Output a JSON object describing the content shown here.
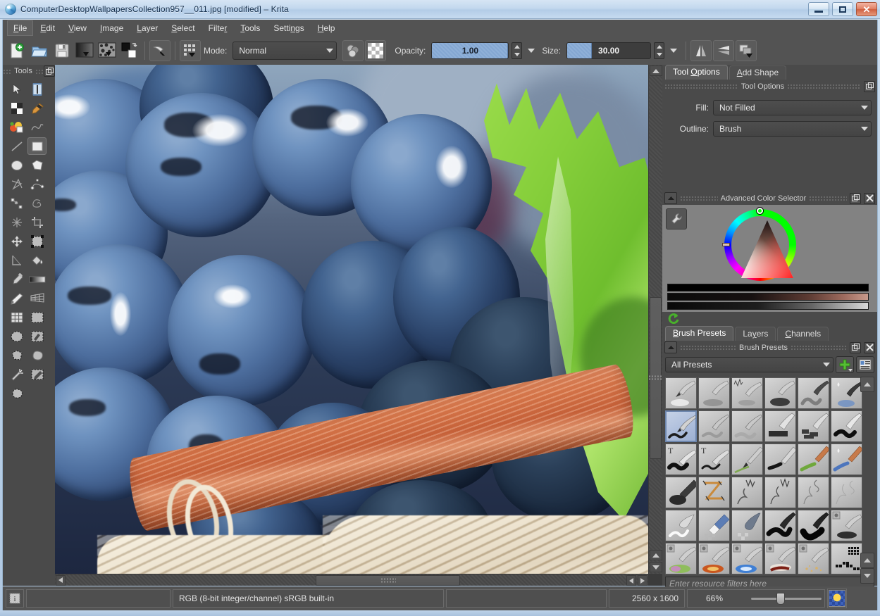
{
  "window": {
    "title": "ComputerDesktopWallpapersCollection957__011.jpg [modified] – Krita",
    "app_icon": "krita-logo-icon",
    "buttons": {
      "minimize": "minimize-icon",
      "maximize": "maximize-icon",
      "close": "close-icon"
    }
  },
  "menubar": {
    "items": [
      {
        "label": "File",
        "mnemonic": "F",
        "active": true
      },
      {
        "label": "Edit",
        "mnemonic": "E",
        "active": false
      },
      {
        "label": "View",
        "mnemonic": "V",
        "active": false
      },
      {
        "label": "Image",
        "mnemonic": "I",
        "active": false
      },
      {
        "label": "Layer",
        "mnemonic": "L",
        "active": false
      },
      {
        "label": "Select",
        "mnemonic": "S",
        "active": false
      },
      {
        "label": "Filter",
        "mnemonic": "r",
        "active": false
      },
      {
        "label": "Tools",
        "mnemonic": "T",
        "active": false
      },
      {
        "label": "Settings",
        "mnemonic": "n",
        "active": false
      },
      {
        "label": "Help",
        "mnemonic": "H",
        "active": false
      }
    ]
  },
  "toolbar": {
    "buttons": [
      {
        "name": "new-document-button",
        "icon": "new-document-icon"
      },
      {
        "name": "open-document-button",
        "icon": "open-folder-icon"
      },
      {
        "name": "save-document-button",
        "icon": "floppy-disk-icon"
      },
      {
        "name": "gradient-button",
        "icon": "gradient-swatch-icon"
      },
      {
        "name": "pattern-button",
        "icon": "pattern-swatch-icon"
      },
      {
        "name": "foreground-background-color-button",
        "icon": "color-swatches-icon"
      },
      {
        "name": "brush-preset-button",
        "icon": "brush-tip-icon"
      },
      {
        "name": "brush-editor-button",
        "icon": "brush-settings-icon"
      }
    ],
    "mode_label": "Mode:",
    "mode_value": "Normal",
    "alpha_lock_button": "alpha-lock-icon",
    "erase_mode_button": "eraser-checker-icon",
    "opacity_label": "Opacity:",
    "opacity_value": "1.00",
    "opacity_fill_percent": 100,
    "size_label": "Size:",
    "size_value": "30.00",
    "size_fill_percent": 30,
    "right_buttons": [
      {
        "name": "mirror-horizontal-button",
        "icon": "mirror-horizontal-icon"
      },
      {
        "name": "mirror-vertical-button",
        "icon": "mirror-vertical-icon"
      },
      {
        "name": "workspace-button",
        "icon": "workspace-icon"
      }
    ]
  },
  "tools_dock": {
    "title": "Tools",
    "float_button": "float-docker-icon",
    "tools": [
      {
        "name": "shape-select-tool",
        "icon": "cursor-arrow-icon",
        "selected": false
      },
      {
        "name": "text-tool",
        "icon": "text-tool-icon",
        "selected": false
      },
      {
        "name": "pattern-edit-tool",
        "icon": "checker-pattern-icon",
        "selected": false
      },
      {
        "name": "calligraphy-tool",
        "icon": "calligraphy-pen-icon",
        "selected": false
      },
      {
        "name": "gradient-edit-tool",
        "icon": "gradient-edit-icon",
        "selected": false
      },
      {
        "name": "freehand-path-tool",
        "icon": "freehand-squiggle-icon",
        "selected": false
      },
      {
        "name": "line-tool",
        "icon": "line-diagonal-icon",
        "selected": false
      },
      {
        "name": "rectangle-tool",
        "icon": "rectangle-icon",
        "selected": true
      },
      {
        "name": "ellipse-tool",
        "icon": "ellipse-icon",
        "selected": false
      },
      {
        "name": "polygon-tool",
        "icon": "polygon-icon",
        "selected": false
      },
      {
        "name": "polyline-tool",
        "icon": "polyline-star-icon",
        "selected": false
      },
      {
        "name": "bezier-curve-tool",
        "icon": "bezier-curve-icon",
        "selected": false
      },
      {
        "name": "path-edit-tool",
        "icon": "path-nodes-icon",
        "selected": false
      },
      {
        "name": "dynamic-brush-tool",
        "icon": "dynamic-spiral-icon",
        "selected": false
      },
      {
        "name": "multibrush-tool",
        "icon": "multibrush-star-icon",
        "selected": false
      },
      {
        "name": "crop-tool",
        "icon": "crop-icon",
        "selected": false
      },
      {
        "name": "move-tool",
        "icon": "move-cross-icon",
        "selected": false
      },
      {
        "name": "transform-tool",
        "icon": "transform-icon",
        "selected": false
      },
      {
        "name": "measure-tool",
        "icon": "measure-angle-icon",
        "selected": false
      },
      {
        "name": "fill-tool",
        "icon": "paint-bucket-icon",
        "selected": false
      },
      {
        "name": "color-picker-tool",
        "icon": "eyedropper-icon",
        "selected": false
      },
      {
        "name": "gradient-tool",
        "icon": "gradient-bar-icon",
        "selected": false
      },
      {
        "name": "pencil-tool",
        "icon": "pencil-icon",
        "selected": false
      },
      {
        "name": "perspective-grid-tool",
        "icon": "perspective-grid-icon",
        "selected": false
      },
      {
        "name": "grid-tool",
        "icon": "grid-icon",
        "selected": false
      },
      {
        "name": "rectangular-select-tool",
        "icon": "marquee-rectangle-icon",
        "selected": false
      },
      {
        "name": "elliptical-select-tool",
        "icon": "marquee-ellipse-icon",
        "selected": false
      },
      {
        "name": "paint-select-tool",
        "icon": "brush-select-icon",
        "selected": false
      },
      {
        "name": "polygonal-select-tool",
        "icon": "polygonal-select-icon",
        "selected": false
      },
      {
        "name": "outline-select-tool",
        "icon": "lasso-select-icon",
        "selected": false
      },
      {
        "name": "magic-wand-select-tool",
        "icon": "magic-wand-icon",
        "selected": false
      },
      {
        "name": "similar-color-select-tool",
        "icon": "eyedropper-select-icon",
        "selected": false
      },
      {
        "name": "contiguous-select-tool",
        "icon": "contiguous-select-icon",
        "selected": false
      }
    ]
  },
  "right_dock": {
    "top_tabs": [
      {
        "label": "Tool Options",
        "mnemonic": "O",
        "active": true
      },
      {
        "label": "Add Shape",
        "mnemonic": "A",
        "active": false
      }
    ],
    "tool_options": {
      "title": "Tool Options",
      "float_button": "float-docker-icon",
      "fields": [
        {
          "label": "Fill:",
          "value": "Not Filled",
          "name": "fill-combo"
        },
        {
          "label": "Outline:",
          "value": "Brush",
          "name": "outline-combo"
        }
      ]
    },
    "color_selector": {
      "title": "Advanced Color Selector",
      "collapse_button": "collapse-icon",
      "float_button": "float-docker-icon",
      "close_button": "close-docker-icon",
      "settings_button": "wrench-icon",
      "reset_button": "refresh-green-icon",
      "wheel_icon": "color-wheel-triangle-icon"
    },
    "presets": {
      "tabs": [
        {
          "label": "Brush Presets",
          "mnemonic": "B",
          "active": true
        },
        {
          "label": "Layers",
          "mnemonic": "y",
          "active": false
        },
        {
          "label": "Channels",
          "mnemonic": "C",
          "active": false
        }
      ],
      "title": "Brush Presets",
      "collapse_button": "collapse-icon",
      "float_button": "float-docker-icon",
      "close_button": "close-docker-icon",
      "filter_value": "All Presets",
      "add_button": "plus-green-icon",
      "view_button": "list-view-icon",
      "scroll_up_button": "scroll-up-icon",
      "scroll_down_button": "scroll-down-icon",
      "search_placeholder": "Enter resource filters here",
      "selected_index": 6,
      "items": [
        {
          "name": "preset-airbrush-soft",
          "kind": "pen-dots"
        },
        {
          "name": "preset-airbrush-pressure",
          "kind": "pen-smudge"
        },
        {
          "name": "preset-airbrush-wiggle",
          "kind": "pen-wave"
        },
        {
          "name": "preset-basic-airbrush",
          "kind": "pen-blob"
        },
        {
          "name": "preset-basic-wet",
          "kind": "pen-wet"
        },
        {
          "name": "preset-basic-wet-soft",
          "kind": "pen-bluewet"
        },
        {
          "name": "preset-ink-ballpen",
          "kind": "pen-curve"
        },
        {
          "name": "preset-ink-gpen",
          "kind": "pen-soft"
        },
        {
          "name": "preset-ink-gpen-soft",
          "kind": "pen-soft2"
        },
        {
          "name": "preset-marker-chisel",
          "kind": "marker-chisel"
        },
        {
          "name": "preset-marker-dry",
          "kind": "marker-dry"
        },
        {
          "name": "preset-marker-rough",
          "kind": "marker-rough"
        },
        {
          "name": "preset-ink-brush-t",
          "kind": "brush-t1"
        },
        {
          "name": "preset-ink-tilt-t",
          "kind": "brush-t2"
        },
        {
          "name": "preset-bristle-thin",
          "kind": "bristle-green"
        },
        {
          "name": "preset-bristle-ink",
          "kind": "bristle-black"
        },
        {
          "name": "preset-bristle-wet",
          "kind": "bristle-greenwet"
        },
        {
          "name": "preset-bristle-blue",
          "kind": "bristle-blue"
        },
        {
          "name": "preset-block-tilt",
          "kind": "block-tilt"
        },
        {
          "name": "preset-sketch-zigzag",
          "kind": "sketch-z"
        },
        {
          "name": "preset-sketch-hatch",
          "kind": "sketch-hatch"
        },
        {
          "name": "preset-sketch-fine",
          "kind": "sketch-fine"
        },
        {
          "name": "preset-sketch-loose",
          "kind": "sketch-loose"
        },
        {
          "name": "preset-sketch-faint",
          "kind": "sketch-faint"
        },
        {
          "name": "preset-smudge-soft",
          "kind": "smudge-soft"
        },
        {
          "name": "preset-eraser-soft",
          "kind": "eraser-soft"
        },
        {
          "name": "preset-eraser-hard",
          "kind": "eraser-hard"
        },
        {
          "name": "preset-ink-marker-thin",
          "kind": "ink-thin"
        },
        {
          "name": "preset-ink-marker-thick",
          "kind": "ink-thick"
        },
        {
          "name": "preset-airbrush-texture",
          "kind": "tex-dark"
        },
        {
          "name": "preset-texture-rainbow",
          "kind": "tex-rainbow"
        },
        {
          "name": "preset-texture-fire",
          "kind": "tex-fire"
        },
        {
          "name": "preset-texture-ice",
          "kind": "tex-ice"
        },
        {
          "name": "preset-texture-blood",
          "kind": "tex-blood"
        },
        {
          "name": "preset-texture-spark",
          "kind": "tex-spark"
        },
        {
          "name": "preset-pixel-grid",
          "kind": "pixel-grid"
        }
      ]
    }
  },
  "canvas": {
    "image_description": "close-up photo of blue-purple grapes with green vine leaf and cinnamon stick in wicker basket",
    "hscroll": {
      "name": "canvas-horizontal-scrollbar"
    },
    "vscroll": {
      "name": "canvas-vertical-scrollbar"
    }
  },
  "statusbar": {
    "info_icon": "info-icon",
    "selection_cell": "",
    "color_profile": "RGB (8-bit integer/channel)  sRGB built-in",
    "message_cell": "",
    "image_size": "2560 x 1600",
    "zoom_level": "66%",
    "zoom_slider_name": "zoom-slider",
    "thumbnail_name": "canvas-overview-thumbnail"
  }
}
